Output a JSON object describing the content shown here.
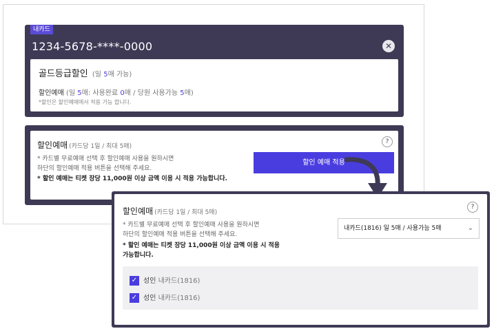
{
  "card": {
    "badge": "내카드",
    "number": "1234-5678-****-0000",
    "close_icon": "close-icon"
  },
  "grade": {
    "title": "골드등급할인",
    "sub_prefix": "(일 ",
    "sub_count": "5",
    "sub_suffix": "매 가능)",
    "line_label": "할인예매",
    "line_p1": " (일 ",
    "line_n1": "5",
    "line_p2": "매: 사용완료 ",
    "line_n2": "0",
    "line_p3": "매 / 당원 사용가능 ",
    "line_n3": "5",
    "line_p4": "매)",
    "note": "*할인은 할인예매에서 적용 가능 합니다."
  },
  "discount": {
    "title": "할인예매",
    "sub": "(카드당 1일 / 최대 5매)",
    "help": "?",
    "desc1": "* 카드별 무료예매 선택 후 할인예매 사용을 원하시면",
    "desc2": "하단의 할인예매 적용 버튼을 선택해 주세요.",
    "desc_strong": "* 할인 예매는 티켓 장당 11,000원 이상 금액 이용 시 적용 가능합니다.",
    "apply_button": "할인 예매 적용"
  },
  "front": {
    "title": "할인예매",
    "sub": "(카드당 1일 / 최대 5매)",
    "help": "?",
    "desc1": "* 카드별 무료예매 선택 후 할인예매 사용을 원하시면",
    "desc2": "하단의 할인예매 적용 버튼을 선택해 주세요.",
    "desc_strong1": "* 할인 예매는 티켓 장당 11,000원 이상 금액 이용 시 적용",
    "desc_strong2": "가능합니다.",
    "select_value": "내카드(1816) 일 5매 / 사용가능 5매",
    "checks": [
      {
        "label": "성인",
        "sub": "내카드(1816)"
      },
      {
        "label": "성인",
        "sub": "내카드(1816)"
      }
    ]
  },
  "colors": {
    "panel": "#3e3a55",
    "accent": "#4a3de0"
  }
}
